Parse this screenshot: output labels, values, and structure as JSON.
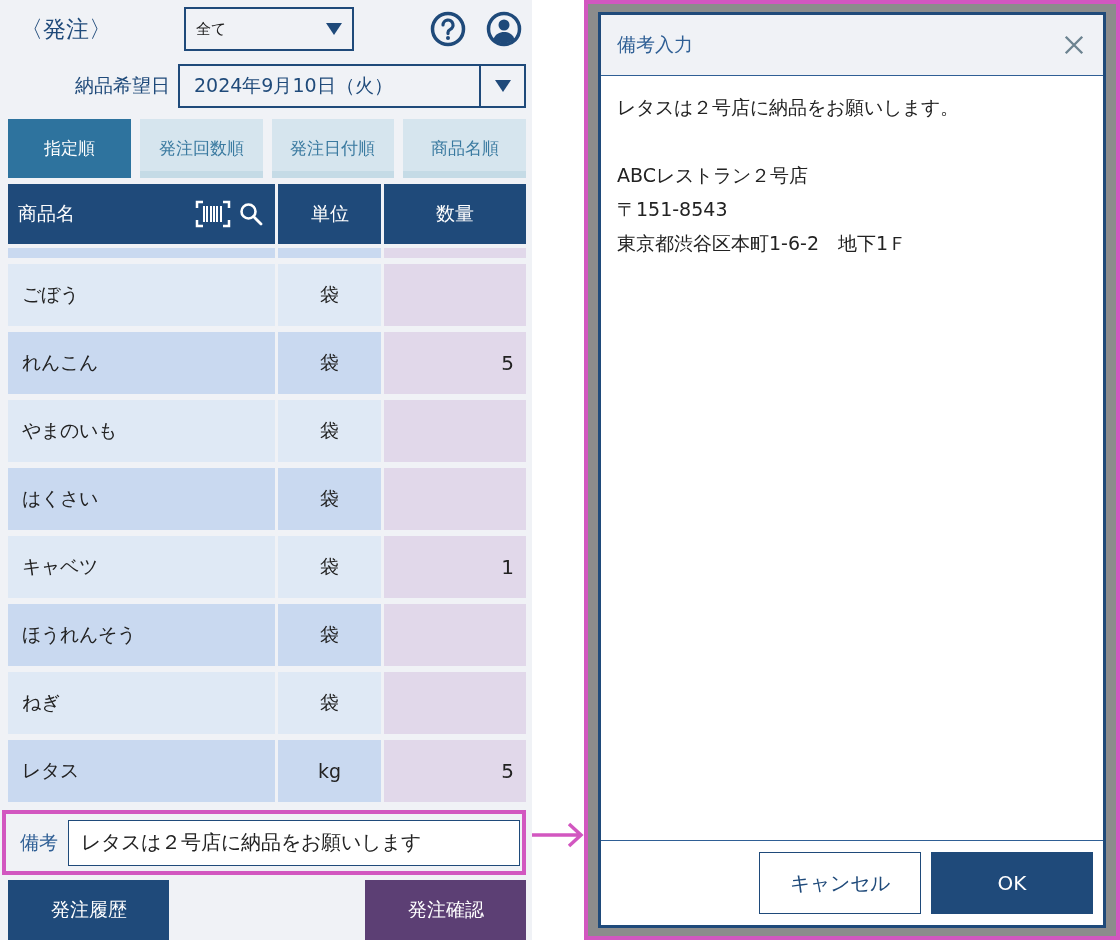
{
  "order_screen": {
    "back_label": "〈発注〉",
    "filter": {
      "value": "全て"
    },
    "delivery_date": {
      "label": "納品希望日",
      "value": "2024年9月10日（火）"
    },
    "sort_tabs": [
      {
        "label": "指定順",
        "selected": true
      },
      {
        "label": "発注回数順",
        "selected": false
      },
      {
        "label": "発注日付順",
        "selected": false
      },
      {
        "label": "商品名順",
        "selected": false
      }
    ],
    "table": {
      "columns": [
        "商品名",
        "単位",
        "数量"
      ],
      "rows": [
        {
          "name": "ごぼう",
          "unit": "袋"
        },
        {
          "name": "れんこん",
          "unit": "袋",
          "quantity": "5"
        },
        {
          "name": "やまのいも",
          "unit": "袋"
        },
        {
          "name": "はくさい",
          "unit": "袋"
        },
        {
          "name": "キャベツ",
          "unit": "袋",
          "quantity": "1"
        },
        {
          "name": "ほうれんそう",
          "unit": "袋"
        },
        {
          "name": "ねぎ",
          "unit": "袋"
        },
        {
          "name": "レタス",
          "unit": "kg",
          "quantity": "5"
        }
      ]
    },
    "remarks": {
      "label": "備考",
      "value": "レタスは２号店に納品をお願いします"
    },
    "buttons": [
      {
        "label": "発注履歴",
        "kind": "history"
      },
      {
        "label": "発注確認",
        "kind": "confirm"
      }
    ]
  },
  "dialog": {
    "title": "備考入力",
    "paragraphs": [
      [
        "レタスは２号店に納品をお願いします。"
      ],
      [
        "ABCレストラン２号店",
        "〒151-8543",
        "東京都渋谷区本町1-6-2　地下1Ｆ"
      ]
    ],
    "buttons": [
      {
        "label": "キャンセル",
        "kind": "secondary"
      },
      {
        "label": "OK",
        "kind": "primary"
      }
    ]
  }
}
